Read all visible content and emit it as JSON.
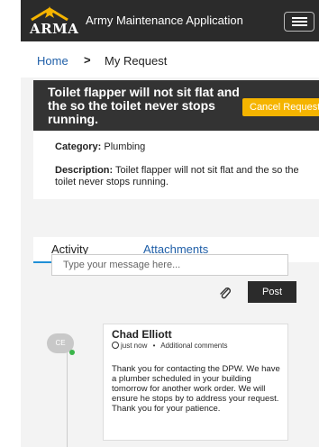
{
  "header": {
    "logo_text": "ARMA",
    "app_title": "Army Maintenance Application",
    "menu_icon": "hamburger-icon"
  },
  "breadcrumb": {
    "home": "Home",
    "separator": ">",
    "current": "My Request"
  },
  "request": {
    "title": "Toilet flapper will not sit flat and the so the toilet never stops running.",
    "cancel_label": "Cancel Request",
    "category_label": "Category:",
    "category_value": "Plumbing",
    "description_label": "Description:",
    "description_value": "Toilet flapper will not sit flat and the so the toilet never stops running."
  },
  "tabs": [
    {
      "label": "Activity",
      "active": true
    },
    {
      "label": "Attachments",
      "active": false
    }
  ],
  "composer": {
    "placeholder": "Type your message here...",
    "attach_icon": "paperclip-icon",
    "post_label": "Post"
  },
  "activity": [
    {
      "initials": "CE",
      "author": "Chad Elliott",
      "time": "just now",
      "separator": "•",
      "type": "Additional comments",
      "message": "Thank you for contacting the DPW. We have a plumber scheduled in your building tomorrow for another work order.  We will ensure he stops by to address your request.  Thank you for your patience."
    }
  ],
  "colors": {
    "header_bg": "#2b2b2b",
    "accent": "#f5b400",
    "link": "#1f5fa8",
    "tab_underline": "#1f8fd6",
    "online": "#3ab54a"
  }
}
